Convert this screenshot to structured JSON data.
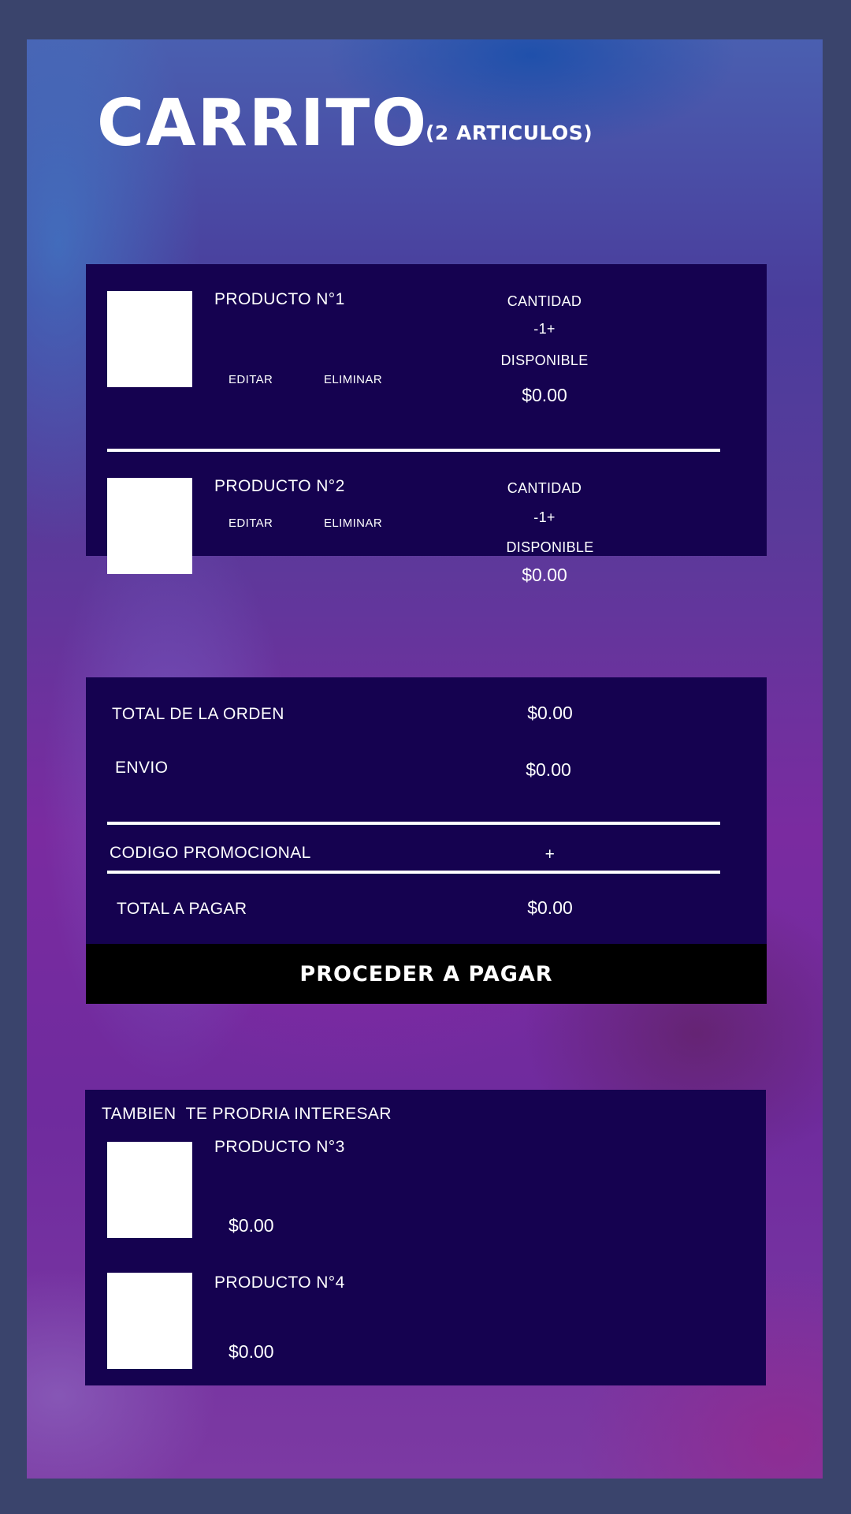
{
  "header": {
    "title": "CARRITO",
    "subtitle": "(2 ARTICULOS)"
  },
  "cart": {
    "items": [
      {
        "name": "PRODUCTO N°1",
        "edit_label": "EDITAR",
        "remove_label": "ELIMINAR",
        "quantity_label": "CANTIDAD",
        "quantity_value": "-1+",
        "availability": "DISPONIBLE",
        "price": "$0.00"
      },
      {
        "name": "PRODUCTO N°2",
        "edit_label": "EDITAR",
        "remove_label": "ELIMINAR",
        "quantity_label": "CANTIDAD",
        "quantity_value": "-1+",
        "availability": "DISPONIBLE",
        "price": "$0.00"
      }
    ]
  },
  "summary": {
    "order_total_label": "TOTAL DE LA ORDEN",
    "order_total_value": "$0.00",
    "shipping_label": "ENVIO",
    "shipping_value": "$0.00",
    "promo_label": "CODIGO PROMOCIONAL",
    "promo_add": "+",
    "total_label": "TOTAL A PAGAR",
    "total_value": "$0.00",
    "checkout_label": "PROCEDER A PAGAR"
  },
  "suggestions": {
    "heading": "TAMBIEN  TE PRODRIA INTERESAR",
    "items": [
      {
        "name": "PRODUCTO N°3",
        "price": "$0.00"
      },
      {
        "name": "PRODUCTO N°4",
        "price": "$0.00"
      }
    ]
  }
}
